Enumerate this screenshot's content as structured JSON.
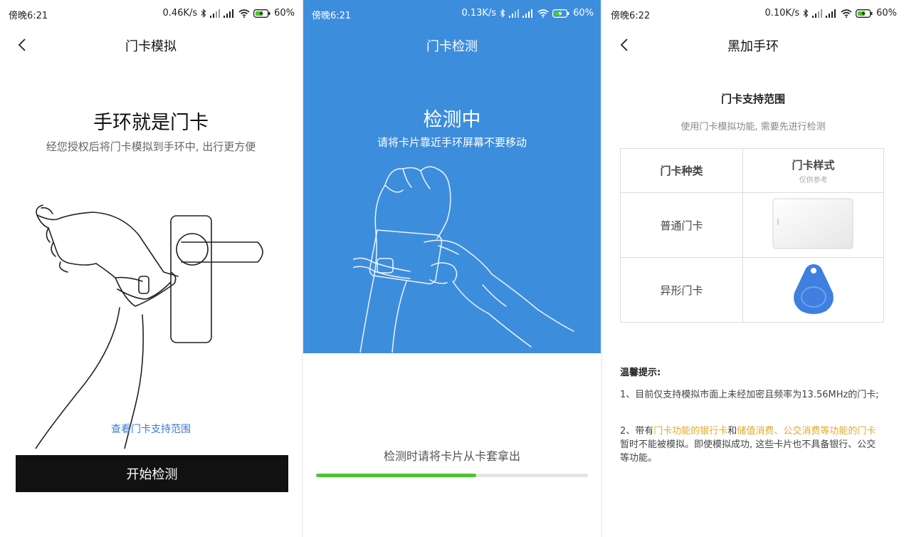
{
  "screens": [
    {
      "status": {
        "time": "傍晚6:21",
        "speed": "0.46K/s",
        "battery": "60%"
      },
      "nav_title": "门卡模拟",
      "hero": "手环就是门卡",
      "subtitle": "经您授权后将门卡模拟到手环中, 出行更方便",
      "link": "查看门卡支持范围",
      "button": "开始检测"
    },
    {
      "status": {
        "time": "傍晚6:21",
        "speed": "0.13K/s",
        "battery": "60%"
      },
      "nav_title": "门卡检测",
      "hero": "检测中",
      "subtitle": "请将卡片靠近手环屏幕不要移动",
      "hint": "检测时请将卡片从卡套拿出",
      "progress": 0.59,
      "progress_color": "#4cc530",
      "background_color": "#3d8ddd"
    },
    {
      "status": {
        "time": "傍晚6:22",
        "speed": "0.10K/s",
        "battery": "60%"
      },
      "nav_title": "黑加手环",
      "section_title": "门卡支持范围",
      "section_sub": "使用门卡模拟功能, 需要先进行检测",
      "table": {
        "headers": [
          "门卡种类",
          "门卡样式"
        ],
        "header_note": "仅供参考",
        "rows": [
          {
            "type": "普通门卡",
            "image": "white-card"
          },
          {
            "type": "异形门卡",
            "image": "blue-key-fob"
          }
        ]
      },
      "tips_title": "温馨提示:",
      "tip1": "1、目前仅支持模拟市面上未经加密且频率为13.56MHz的门卡;",
      "tip2": {
        "prefix": "2、带有",
        "hl1": "门卡功能的银行卡",
        "mid": "和",
        "hl2": "储值消费、公交消费等功能的门卡",
        "suffix": "暂时不能被模拟。即使模拟成功, 这些卡片也不具备银行、公交等功能。",
        "highlight_color": "#e5a82a"
      }
    }
  ]
}
